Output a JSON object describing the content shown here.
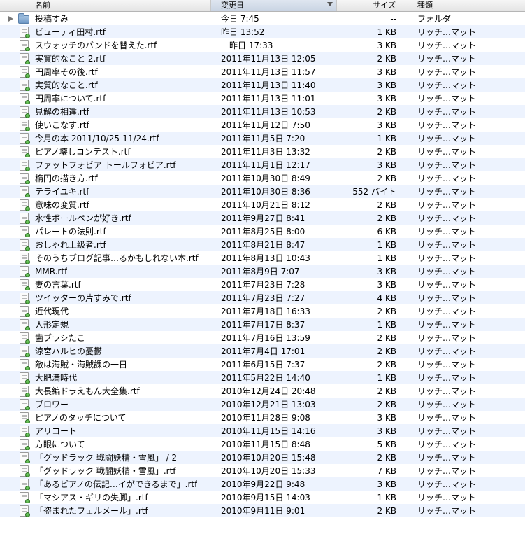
{
  "columns": {
    "name": "名前",
    "date": "変更日",
    "size": "サイズ",
    "kind": "種類"
  },
  "rows": [
    {
      "name": "投稿すみ",
      "date": "今日 7:45",
      "size": "--",
      "kind": "フォルダ",
      "type": "folder"
    },
    {
      "name": "ビューティ田村.rtf",
      "date": "昨日 13:52",
      "size": "1 KB",
      "kind": "リッチ…マット",
      "type": "rtf"
    },
    {
      "name": "スウォッチのバンドを替えた.rtf",
      "date": "一昨日 17:33",
      "size": "3 KB",
      "kind": "リッチ…マット",
      "type": "rtf"
    },
    {
      "name": "実質的なこと 2.rtf",
      "date": "2011年11月13日 12:05",
      "size": "2 KB",
      "kind": "リッチ…マット",
      "type": "rtf"
    },
    {
      "name": "円周率その後.rtf",
      "date": "2011年11月13日 11:57",
      "size": "3 KB",
      "kind": "リッチ…マット",
      "type": "rtf"
    },
    {
      "name": "実質的なこと.rtf",
      "date": "2011年11月13日 11:40",
      "size": "3 KB",
      "kind": "リッチ…マット",
      "type": "rtf"
    },
    {
      "name": "円周率について.rtf",
      "date": "2011年11月13日 11:01",
      "size": "3 KB",
      "kind": "リッチ…マット",
      "type": "rtf"
    },
    {
      "name": "見解の相違.rtf",
      "date": "2011年11月13日 10:53",
      "size": "2 KB",
      "kind": "リッチ…マット",
      "type": "rtf"
    },
    {
      "name": "使いこなす.rtf",
      "date": "2011年11月12日 7:50",
      "size": "3 KB",
      "kind": "リッチ…マット",
      "type": "rtf"
    },
    {
      "name": "今月の本 2011/10/25-11/24.rtf",
      "date": "2011年11月5日 7:20",
      "size": "1 KB",
      "kind": "リッチ…マット",
      "type": "rtf"
    },
    {
      "name": "ピアノ壊しコンテスト.rtf",
      "date": "2011年11月3日 13:32",
      "size": "2 KB",
      "kind": "リッチ…マット",
      "type": "rtf"
    },
    {
      "name": "ファットフォビア トールフォビア.rtf",
      "date": "2011年11月1日 12:17",
      "size": "3 KB",
      "kind": "リッチ…マット",
      "type": "rtf"
    },
    {
      "name": "楕円の描き方.rtf",
      "date": "2011年10月30日 8:49",
      "size": "2 KB",
      "kind": "リッチ…マット",
      "type": "rtf"
    },
    {
      "name": "テライユキ.rtf",
      "date": "2011年10月30日 8:36",
      "size": "552 バイト",
      "kind": "リッチ…マット",
      "type": "rtf"
    },
    {
      "name": "意味の変質.rtf",
      "date": "2011年10月21日 8:12",
      "size": "2 KB",
      "kind": "リッチ…マット",
      "type": "rtf"
    },
    {
      "name": "水性ボールペンが好き.rtf",
      "date": "2011年9月27日 8:41",
      "size": "2 KB",
      "kind": "リッチ…マット",
      "type": "rtf"
    },
    {
      "name": "パレートの法則.rtf",
      "date": "2011年8月25日 8:00",
      "size": "6 KB",
      "kind": "リッチ…マット",
      "type": "rtf"
    },
    {
      "name": "おしゃれ上級者.rtf",
      "date": "2011年8月21日 8:47",
      "size": "1 KB",
      "kind": "リッチ…マット",
      "type": "rtf"
    },
    {
      "name": "そのうちブログ記事…るかもしれない本.rtf",
      "date": "2011年8月13日 10:43",
      "size": "1 KB",
      "kind": "リッチ…マット",
      "type": "rtf"
    },
    {
      "name": "MMR.rtf",
      "date": "2011年8月9日 7:07",
      "size": "3 KB",
      "kind": "リッチ…マット",
      "type": "rtf"
    },
    {
      "name": "妻の言葉.rtf",
      "date": "2011年7月23日 7:28",
      "size": "3 KB",
      "kind": "リッチ…マット",
      "type": "rtf"
    },
    {
      "name": "ツイッターの片すみで.rtf",
      "date": "2011年7月23日 7:27",
      "size": "4 KB",
      "kind": "リッチ…マット",
      "type": "rtf"
    },
    {
      "name": "近代現代",
      "date": "2011年7月18日 16:33",
      "size": "2 KB",
      "kind": "リッチ…マット",
      "type": "rtf"
    },
    {
      "name": "人形定規",
      "date": "2011年7月17日 8:37",
      "size": "1 KB",
      "kind": "リッチ…マット",
      "type": "rtf"
    },
    {
      "name": "歯ブラシたこ",
      "date": "2011年7月16日 13:59",
      "size": "2 KB",
      "kind": "リッチ…マット",
      "type": "rtf"
    },
    {
      "name": "涼宮ハルヒの憂鬱",
      "date": "2011年7月4日 17:01",
      "size": "2 KB",
      "kind": "リッチ…マット",
      "type": "rtf"
    },
    {
      "name": "敵は海賊・海賊課の一日",
      "date": "2011年6月15日 7:37",
      "size": "2 KB",
      "kind": "リッチ…マット",
      "type": "rtf"
    },
    {
      "name": "大肥満時代",
      "date": "2011年5月22日 14:40",
      "size": "1 KB",
      "kind": "リッチ…マット",
      "type": "rtf"
    },
    {
      "name": "大長編ドラえもん大全集.rtf",
      "date": "2010年12月24日 20:48",
      "size": "2 KB",
      "kind": "リッチ…マット",
      "type": "rtf"
    },
    {
      "name": "ブロワー",
      "date": "2010年12月21日 13:03",
      "size": "2 KB",
      "kind": "リッチ…マット",
      "type": "rtf"
    },
    {
      "name": "ピアノのタッチについて",
      "date": "2010年11月28日 9:08",
      "size": "3 KB",
      "kind": "リッチ…マット",
      "type": "rtf"
    },
    {
      "name": "アリコート",
      "date": "2010年11月15日 14:16",
      "size": "3 KB",
      "kind": "リッチ…マット",
      "type": "rtf"
    },
    {
      "name": "方眼について",
      "date": "2010年11月15日 8:48",
      "size": "5 KB",
      "kind": "リッチ…マット",
      "type": "rtf"
    },
    {
      "name": "「グッドラック 戦闘妖精・雪風」 / 2",
      "date": "2010年10月20日 15:48",
      "size": "2 KB",
      "kind": "リッチ…マット",
      "type": "rtf"
    },
    {
      "name": "「グッドラック 戦闘妖精・雪風」.rtf",
      "date": "2010年10月20日 15:33",
      "size": "7 KB",
      "kind": "リッチ…マット",
      "type": "rtf"
    },
    {
      "name": "「あるピアノの伝記…イができるまで」.rtf",
      "date": "2010年9月22日 9:48",
      "size": "3 KB",
      "kind": "リッチ…マット",
      "type": "rtf"
    },
    {
      "name": "「マシアス・ギリの失脚」.rtf",
      "date": "2010年9月15日 14:03",
      "size": "1 KB",
      "kind": "リッチ…マット",
      "type": "rtf"
    },
    {
      "name": "「盗まれたフェルメール」.rtf",
      "date": "2010年9月11日 9:01",
      "size": "2 KB",
      "kind": "リッチ…マット",
      "type": "rtf"
    }
  ],
  "colors": {
    "alt_row": "#edf3fe",
    "sorted_header": "#c9d4e3"
  },
  "icons": {
    "folder": "folder-icon",
    "rtf": "rtf-document-icon",
    "disclosure": "disclosure-triangle-icon",
    "sort": "sort-descending-icon"
  }
}
